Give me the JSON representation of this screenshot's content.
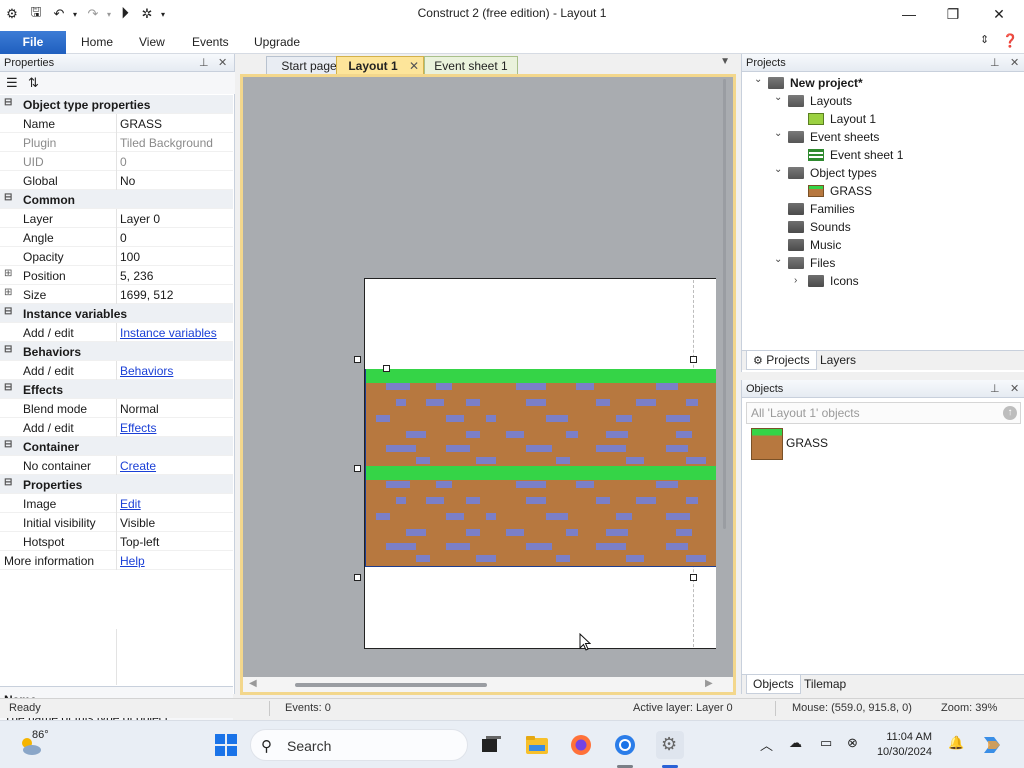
{
  "window": {
    "title": "Construct 2  (free edition) - Layout 1",
    "minimize": "—",
    "maximize": "❐",
    "close": "✕"
  },
  "ribbon": {
    "file": "File",
    "tabs": [
      "Home",
      "View",
      "Events",
      "Upgrade"
    ]
  },
  "properties_panel": {
    "title": "Properties",
    "rows": [
      {
        "type": "cat",
        "key": "Object type properties"
      },
      {
        "type": "row",
        "key": "Name",
        "value": "GRASS"
      },
      {
        "type": "row",
        "key": "Plugin",
        "value": "Tiled Background",
        "dim": true
      },
      {
        "type": "row",
        "key": "UID",
        "value": "0",
        "dim": true
      },
      {
        "type": "row",
        "key": "Global",
        "value": "No"
      },
      {
        "type": "cat",
        "key": "Common"
      },
      {
        "type": "row",
        "key": "Layer",
        "value": "Layer 0"
      },
      {
        "type": "row",
        "key": "Angle",
        "value": "0"
      },
      {
        "type": "row",
        "key": "Opacity",
        "value": "100"
      },
      {
        "type": "row",
        "key": "Position",
        "value": "5, 236",
        "expand": true
      },
      {
        "type": "row",
        "key": "Size",
        "value": "1699, 512",
        "expand": true
      },
      {
        "type": "cat",
        "key": "Instance variables"
      },
      {
        "type": "row",
        "key": "Add / edit",
        "value": "Instance variables",
        "link": true
      },
      {
        "type": "cat",
        "key": "Behaviors"
      },
      {
        "type": "row",
        "key": "Add / edit",
        "value": "Behaviors",
        "link": true
      },
      {
        "type": "cat",
        "key": "Effects"
      },
      {
        "type": "row",
        "key": "Blend mode",
        "value": "Normal"
      },
      {
        "type": "row",
        "key": "Add / edit",
        "value": "Effects",
        "link": true
      },
      {
        "type": "cat",
        "key": "Container"
      },
      {
        "type": "row",
        "key": "No container",
        "value": "Create",
        "link": true
      },
      {
        "type": "cat",
        "key": "Properties"
      },
      {
        "type": "row",
        "key": "Image",
        "value": "Edit",
        "link": true
      },
      {
        "type": "row",
        "key": "Initial visibility",
        "value": "Visible"
      },
      {
        "type": "row",
        "key": "Hotspot",
        "value": "Top-left"
      },
      {
        "type": "more",
        "key": "More information",
        "value": "Help",
        "link": true
      }
    ],
    "desc_title": "Name",
    "desc_text": "The name of this type of object."
  },
  "doc_tabs": {
    "start": "Start page",
    "layout": "Layout 1",
    "events": "Event sheet 1"
  },
  "projects_panel": {
    "title": "Projects",
    "tree": [
      {
        "level": 0,
        "arrow": "open",
        "icon": "folder-open",
        "label": "New project*",
        "bold": true
      },
      {
        "level": 1,
        "arrow": "open",
        "icon": "folder-open",
        "label": "Layouts"
      },
      {
        "level": 2,
        "arrow": "",
        "icon": "layout",
        "label": "Layout 1"
      },
      {
        "level": 1,
        "arrow": "open",
        "icon": "folder-open",
        "label": "Event sheets"
      },
      {
        "level": 2,
        "arrow": "",
        "icon": "events",
        "label": "Event sheet 1"
      },
      {
        "level": 1,
        "arrow": "open",
        "icon": "folder-open",
        "label": "Object types"
      },
      {
        "level": 2,
        "arrow": "",
        "icon": "grass",
        "label": "GRASS"
      },
      {
        "level": 1,
        "arrow": "",
        "icon": "folder",
        "label": "Families"
      },
      {
        "level": 1,
        "arrow": "",
        "icon": "folder",
        "label": "Sounds"
      },
      {
        "level": 1,
        "arrow": "",
        "icon": "folder",
        "label": "Music"
      },
      {
        "level": 1,
        "arrow": "open",
        "icon": "folder-open",
        "label": "Files"
      },
      {
        "level": 2,
        "arrow": "closed",
        "icon": "folder",
        "label": "Icons"
      }
    ],
    "tab_projects": "Projects",
    "tab_layers": "Layers"
  },
  "objects_panel": {
    "title": "Objects",
    "filter_placeholder": "All 'Layout 1' objects",
    "items": [
      "GRASS"
    ],
    "tab_objects": "Objects",
    "tab_tilemap": "Tilemap"
  },
  "statusbar": {
    "ready": "Ready",
    "events": "Events: 0",
    "active_layer": "Active layer: Layer 0",
    "mouse": "Mouse: (559.0, 915.8, 0)",
    "zoom": "Zoom: 39%"
  },
  "taskbar": {
    "temperature": "86°",
    "search": "Search",
    "time": "11:04 AM",
    "date": "10/30/2024"
  }
}
